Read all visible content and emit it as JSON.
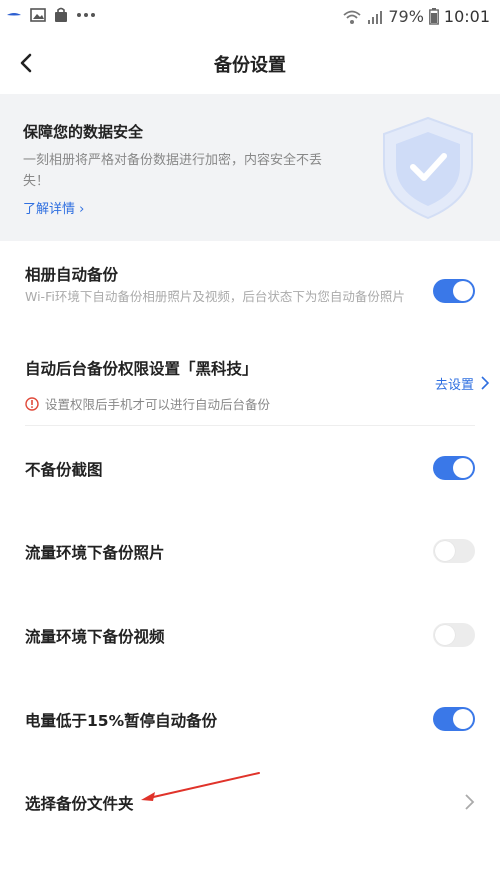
{
  "status_bar": {
    "battery": "79%",
    "time": "10:01"
  },
  "header": {
    "title": "备份设置"
  },
  "banner": {
    "title": "保障您的数据安全",
    "description": "一刻相册将严格对备份数据进行加密，内容安全不丢失！",
    "link": "了解详情 ›"
  },
  "settings": {
    "album_backup": {
      "title": "相册自动备份",
      "subtitle": "Wi-Fi环境下自动备份相册照片及视频，后台状态下为您自动备份照片",
      "enabled": true
    },
    "background_permission": {
      "title": "自动后台备份权限设置「黑科技」",
      "action": "去设置",
      "warning": "设置权限后手机才可以进行自动后台备份"
    },
    "skip_screenshots": {
      "title": "不备份截图",
      "enabled": true
    },
    "cellular_photos": {
      "title": "流量环境下备份照片",
      "enabled": false
    },
    "cellular_videos": {
      "title": "流量环境下备份视频",
      "enabled": false
    },
    "low_battery_pause": {
      "title": "电量低于15%暂停自动备份",
      "enabled": true
    },
    "select_folder": {
      "title": "选择备份文件夹"
    }
  },
  "colors": {
    "accent": "#3a78e8",
    "link": "#2f6fe0",
    "warning": "#e04a3a",
    "annotation_arrow": "#e0332a"
  }
}
